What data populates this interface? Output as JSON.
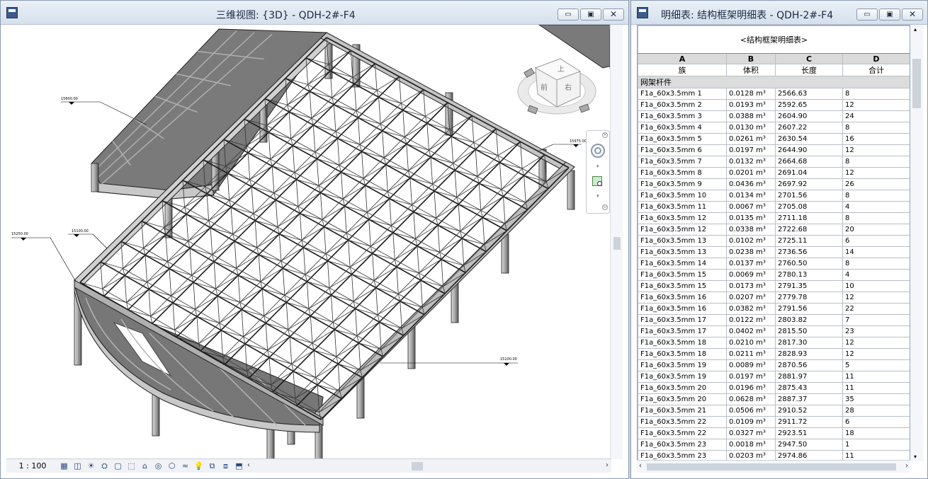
{
  "view3d": {
    "title": "三维视图: {3D} - QDH-2#-F4",
    "scale": "1 : 100",
    "elevations": [
      "15600.00",
      "15975.00",
      "15250.00",
      "15100.00",
      "15100.00"
    ],
    "viewcube_labels": [
      "上",
      "前",
      "右"
    ],
    "window_buttons": {
      "minimize": "▭",
      "restore": "▣",
      "close": "✕"
    },
    "status_icons": [
      "detail-level-icon",
      "visual-style-icon",
      "sun-path-icon",
      "shadows-icon",
      "crop-view-icon",
      "show-crop-icon",
      "unlock-view-icon",
      "temporary-hide-icon",
      "reveal-hidden-icon",
      "analysis-icon",
      "highlight-icon",
      "worksharing-icon",
      "design-options-icon",
      "display-constraints-icon"
    ],
    "status_glyphs": [
      "▦",
      "◫",
      "☀",
      "⛭",
      "▢",
      "⬚",
      "⌂",
      "◎",
      "⬡",
      "≈",
      "💡",
      "⧉",
      "⧈",
      "⬒"
    ]
  },
  "schedule": {
    "window_title": "明细表: 结构框架明细表 - QDH-2#-F4",
    "table_title": "<结构框架明细表>",
    "columns": [
      "A",
      "B",
      "C",
      "D"
    ],
    "fields": [
      "族",
      "体积",
      "长度",
      "合计"
    ],
    "group": "网架杆件",
    "rows": [
      [
        "F1a_60x3.5mm 1",
        "0.0128 m³",
        "2566.63",
        "8"
      ],
      [
        "F1a_60x3.5mm 2",
        "0.0193 m³",
        "2592.65",
        "12"
      ],
      [
        "F1a_60x3.5mm 3",
        "0.0388 m³",
        "2604.90",
        "24"
      ],
      [
        "F1a_60x3.5mm 4",
        "0.0130 m³",
        "2607.22",
        "8"
      ],
      [
        "F1a_60x3.5mm 5",
        "0.0261 m³",
        "2630.54",
        "16"
      ],
      [
        "F1a_60x3.5mm 6",
        "0.0197 m³",
        "2644.90",
        "12"
      ],
      [
        "F1a_60x3.5mm 7",
        "0.0132 m³",
        "2664.68",
        "8"
      ],
      [
        "F1a_60x3.5mm 8",
        "0.0201 m³",
        "2691.04",
        "12"
      ],
      [
        "F1a_60x3.5mm 9",
        "0.0436 m³",
        "2697.92",
        "26"
      ],
      [
        "F1a_60x3.5mm 10",
        "0.0134 m³",
        "2701.56",
        "8"
      ],
      [
        "F1a_60x3.5mm 11",
        "0.0067 m³",
        "2705.08",
        "4"
      ],
      [
        "F1a_60x3.5mm 12",
        "0.0135 m³",
        "2711.18",
        "8"
      ],
      [
        "F1a_60x3.5mm 12",
        "0.0338 m³",
        "2722.68",
        "20"
      ],
      [
        "F1a_60x3.5mm 13",
        "0.0102 m³",
        "2725.11",
        "6"
      ],
      [
        "F1a_60x3.5mm 13",
        "0.0238 m³",
        "2736.56",
        "14"
      ],
      [
        "F1a_60x3.5mm 14",
        "0.0137 m³",
        "2760.50",
        "8"
      ],
      [
        "F1a_60x3.5mm 15",
        "0.0069 m³",
        "2780.13",
        "4"
      ],
      [
        "F1a_60x3.5mm 15",
        "0.0173 m³",
        "2791.35",
        "10"
      ],
      [
        "F1a_60x3.5mm 16",
        "0.0207 m³",
        "2779.78",
        "12"
      ],
      [
        "F1a_60x3.5mm 16",
        "0.0382 m³",
        "2791.56",
        "22"
      ],
      [
        "F1a_60x3.5mm 17",
        "0.0122 m³",
        "2803.82",
        "7"
      ],
      [
        "F1a_60x3.5mm 17",
        "0.0402 m³",
        "2815.50",
        "23"
      ],
      [
        "F1a_60x3.5mm 18",
        "0.0210 m³",
        "2817.30",
        "12"
      ],
      [
        "F1a_60x3.5mm 18",
        "0.0211 m³",
        "2828.93",
        "12"
      ],
      [
        "F1a_60x3.5mm 19",
        "0.0089 m³",
        "2870.56",
        "5"
      ],
      [
        "F1a_60x3.5mm 19",
        "0.0197 m³",
        "2881.97",
        "11"
      ],
      [
        "F1a_60x3.5mm 20",
        "0.0196 m³",
        "2875.43",
        "11"
      ],
      [
        "F1a_60x3.5mm 20",
        "0.0628 m³",
        "2887.37",
        "35"
      ],
      [
        "F1a_60x3.5mm 21",
        "0.0506 m³",
        "2910.52",
        "28"
      ],
      [
        "F1a_60x3.5mm 22",
        "0.0109 m³",
        "2911.72",
        "6"
      ],
      [
        "F1a_60x3.5mm 22",
        "0.0327 m³",
        "2923.51",
        "18"
      ],
      [
        "F1a_60x3.5mm 23",
        "0.0018 m³",
        "2947.50",
        "1"
      ],
      [
        "F1a_60x3.5mm 23",
        "0.0203 m³",
        "2974.86",
        "11"
      ]
    ]
  }
}
